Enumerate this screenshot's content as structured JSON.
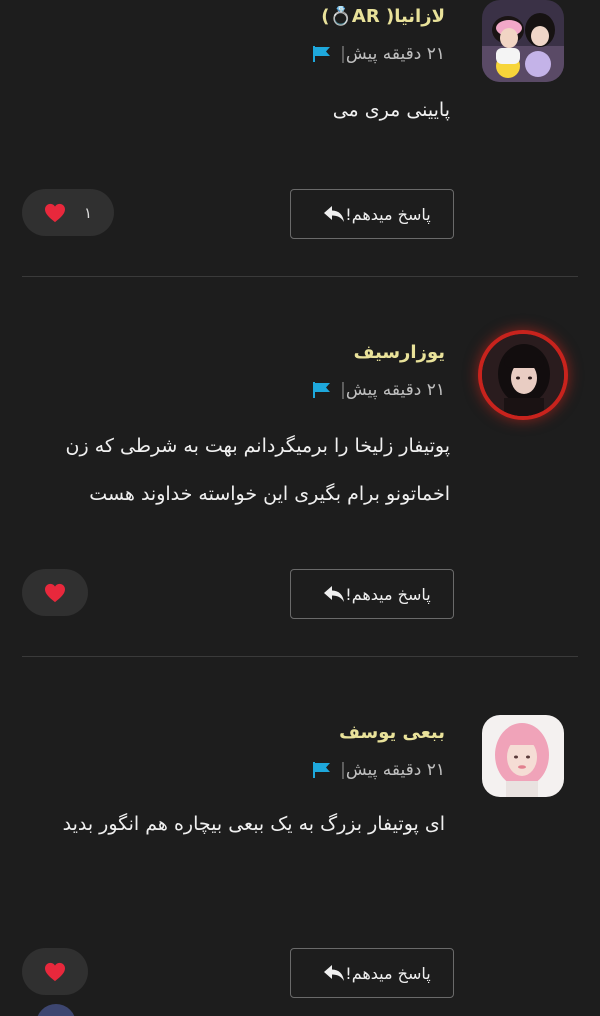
{
  "reply_label": "پاسخ میدهم!",
  "comments": [
    {
      "username": "لازانیا( AR💍)",
      "time": "۲۱ دقیقه پیش",
      "text": "پایینی مری می",
      "likes": "۱",
      "avatar": "avatar-two-girls-with-plush-toys"
    },
    {
      "username": "یوزارسیف",
      "time": "۲۱ دقیقه پیش",
      "text": "پوتیفار زلیخا را برمیگردانم بهت به شرطی که زن اخماتونو برام بگیری این خواسته خداوند هست",
      "likes": "",
      "avatar": "avatar-girl-dark-hair-red-ring"
    },
    {
      "username": "ببعی یوسف",
      "time": "۲۱ دقیقه پیش",
      "text": "ای پوتیفار بزرگ به یک ببعی بیچاره هم انگور بدید",
      "likes": "",
      "avatar": "avatar-girl-pink-hair"
    }
  ],
  "colors": {
    "background": "#1d1d1d",
    "username": "#e9e29a",
    "flag": "#1ea8dc",
    "heart": "#e8283c",
    "avatar_ring": "#c8231d"
  }
}
